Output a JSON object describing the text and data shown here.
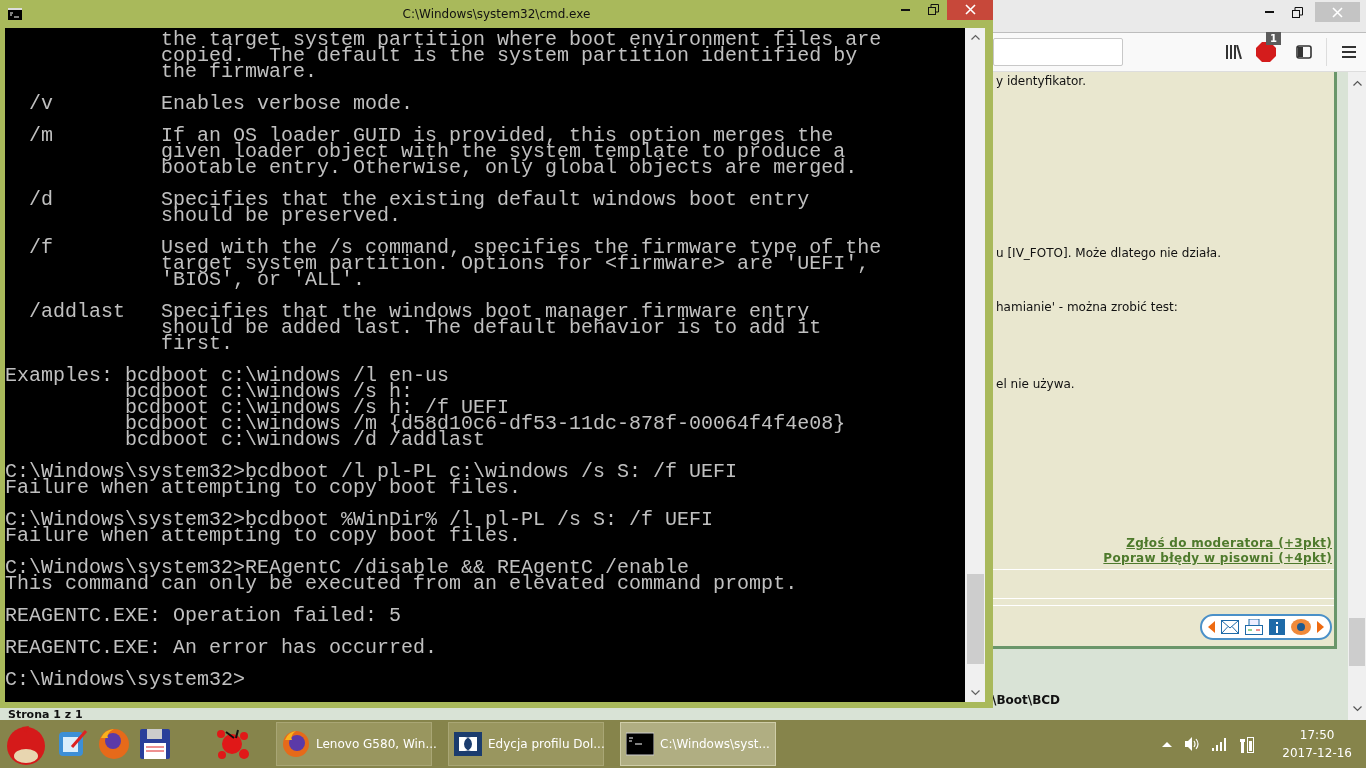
{
  "console_window": {
    "title": "C:\\Windows\\system32\\cmd.exe",
    "blocks": [
      {
        "kind": "output",
        "lines": [
          "             the target system partition where boot environment files are",
          "             copied.  The default is the system partition identified by",
          "             the firmware."
        ]
      },
      {
        "kind": "output",
        "lines": [
          "  /v         Enables verbose mode."
        ]
      },
      {
        "kind": "output",
        "lines": [
          "  /m         If an OS loader GUID is provided, this option merges the",
          "             given loader object with the system template to produce a",
          "             bootable entry. Otherwise, only global objects are merged."
        ]
      },
      {
        "kind": "output",
        "lines": [
          "  /d         Specifies that the existing default windows boot entry",
          "             should be preserved."
        ]
      },
      {
        "kind": "output",
        "lines": [
          "  /f         Used with the /s command, specifies the firmware type of the",
          "             target system partition. Options for <firmware> are 'UEFI',",
          "             'BIOS', or 'ALL'."
        ]
      },
      {
        "kind": "output",
        "lines": [
          "  /addlast   Specifies that the windows boot manager firmware entry",
          "             should be added last. The default behavior is to add it",
          "             first."
        ]
      },
      {
        "kind": "output",
        "lines": [
          "Examples: bcdboot c:\\windows /l en-us",
          "          bcdboot c:\\windows /s h:",
          "          bcdboot c:\\windows /s h: /f UEFI",
          "          bcdboot c:\\windows /m {d58d10c6-df53-11dc-878f-00064f4f4e08}",
          "          bcdboot c:\\windows /d /addlast"
        ]
      },
      {
        "kind": "output",
        "lines": [
          "C:\\Windows\\system32>bcdboot /l pl-PL c:\\windows /s S: /f UEFI",
          "Failure when attempting to copy boot files."
        ]
      },
      {
        "kind": "output",
        "lines": [
          "C:\\Windows\\system32>bcdboot %WinDir% /l pl-PL /s S: /f UEFI",
          "Failure when attempting to copy boot files."
        ]
      },
      {
        "kind": "output",
        "lines": [
          "C:\\Windows\\system32>REAgentC /disable && REAgentC /enable",
          "This command can only be executed from an elevated command prompt."
        ]
      },
      {
        "kind": "output",
        "lines": [
          "REAGENTC.EXE: Operation failed: 5"
        ]
      },
      {
        "kind": "output",
        "lines": [
          "REAGENTC.EXE: An error has occurred."
        ]
      },
      {
        "kind": "prompt",
        "lines": [
          "C:\\Windows\\system32>"
        ]
      }
    ]
  },
  "browser": {
    "toolbar": {
      "badge": "1"
    },
    "content": {
      "texts": [
        {
          "text": "y identyfikator."
        },
        {
          "text": "u [IV_FOTO]. Może dlatego nie działa."
        },
        {
          "text": "hamianie' - można zrobić test:"
        },
        {
          "text": "el nie używa."
        }
      ],
      "links": [
        "Zgłoś do moderatora (+3pkt)",
        "Popraw błędy w pisowni (+4pkt)"
      ],
      "path": "\\Boot\\BCD",
      "status": "Strona 1 z 1"
    }
  },
  "taskbar": {
    "buttons": [
      {
        "kind": "browser",
        "label": "Lenovo G580, Win...",
        "selected": false
      },
      {
        "kind": "dolby",
        "label": "Edycja profilu Dol...",
        "selected": false
      },
      {
        "kind": "console",
        "label": "C:\\Windows\\syst...",
        "selected": true
      }
    ],
    "clock": {
      "time": "17:50",
      "date": "2017-12-16"
    }
  }
}
